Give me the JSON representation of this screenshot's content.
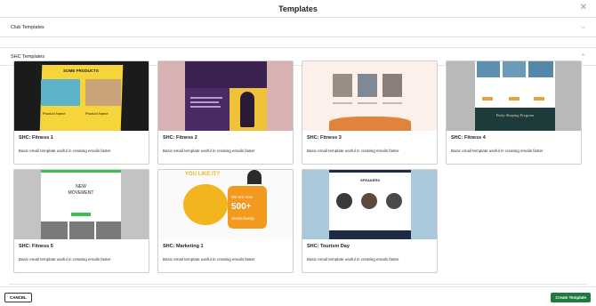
{
  "modal": {
    "title": "Templates"
  },
  "sections": {
    "club": {
      "label": "Club Templates"
    },
    "shc": {
      "label": "SHC Templates"
    }
  },
  "cards": [
    {
      "name": "SHC: Fitness 1",
      "desc": "Basic email template useful in creating emails faster",
      "thumb": {
        "heading": "SOME PRODUCTS",
        "products": [
          "Product Name",
          "Product Name"
        ]
      }
    },
    {
      "name": "SHC: Fitness 2",
      "desc": "Basic email template useful in creating emails faster"
    },
    {
      "name": "SHC: Fitness 3",
      "desc": "Basic email template useful in creating emails faster"
    },
    {
      "name": "SHC: Fitness 4",
      "desc": "Basic email template useful in creating emails faster",
      "thumb": {
        "banner": "Body Shaping Program"
      }
    },
    {
      "name": "SHC: Fitness 5",
      "desc": "Basic email template useful in creating emails faster",
      "thumb": {
        "line1": "NEW",
        "line2": "MOVEMENT"
      }
    },
    {
      "name": "SHC: Marketing 1",
      "desc": "Basic email template useful in creating emails faster",
      "thumb": {
        "headline": "YOU LIKE IT?",
        "sub": "We are now",
        "big": "500+",
        "small": "clients family"
      }
    },
    {
      "name": "SHC: Tourism Day",
      "desc": "Basic email template useful in creating emails faster",
      "thumb": {
        "heading": "SPEAKERS"
      }
    }
  ],
  "footer": {
    "cancel": "CANCEL",
    "create": "Create Template"
  },
  "colors": {
    "primary_button": "#1f7a3d",
    "border": "#cfcfcf"
  }
}
